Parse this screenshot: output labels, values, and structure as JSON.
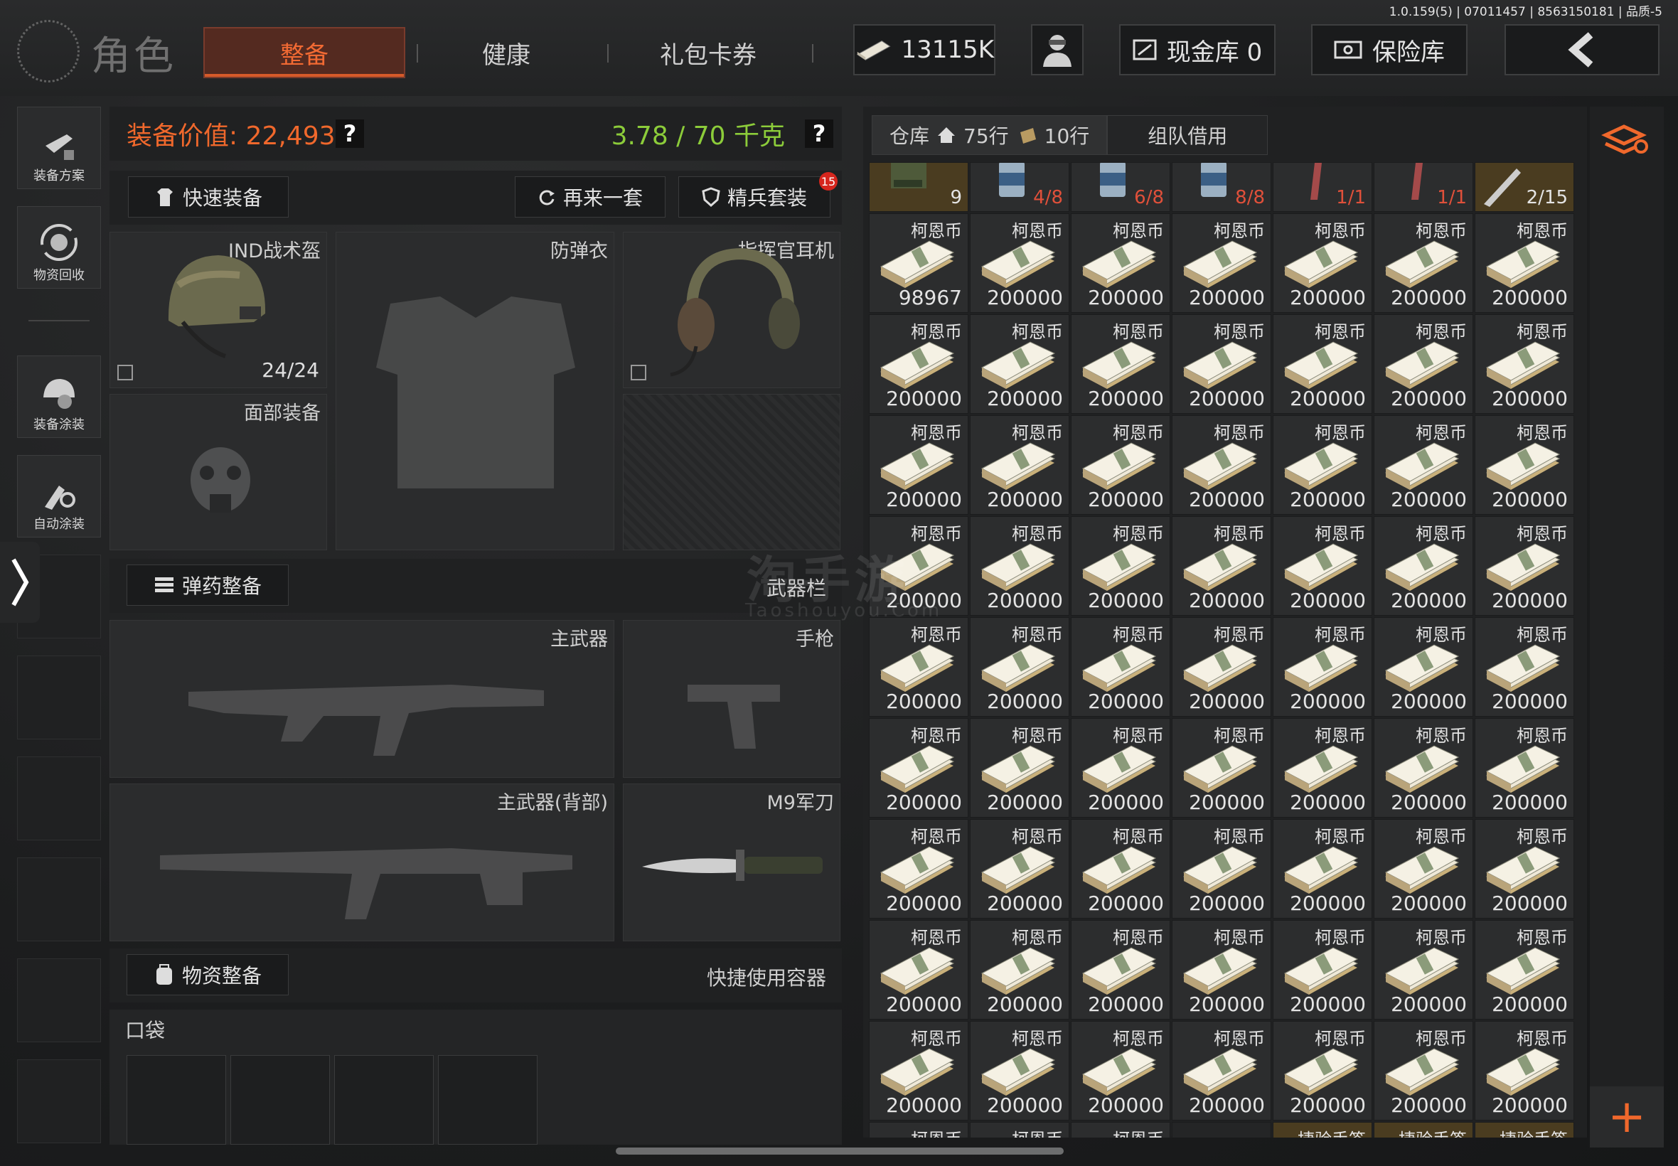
{
  "version_info": "1.0.159(5) | 07011457 | 8563150181 | 品质-5",
  "header": {
    "title": "角色",
    "tabs": [
      {
        "label": "整备",
        "active": true
      },
      {
        "label": "健康",
        "active": false
      },
      {
        "label": "礼包卡券",
        "active": false
      }
    ],
    "money": "13115K",
    "cash_vault": "现金库 0",
    "safe": "保险库"
  },
  "rail": {
    "items": [
      "装备方案",
      "物资回收",
      "装备涂装",
      "自动涂装"
    ]
  },
  "loadout": {
    "equip_value": "装备价值: 22,493",
    "weight": "3.78 / 70 千克",
    "help": "?",
    "quick_equip": "快速装备",
    "reroll": "再来一套",
    "elite_set": "精兵套装",
    "elite_badge": "15",
    "slots": {
      "helmet": {
        "label": "IND战术盔",
        "count": "24/24"
      },
      "armor": {
        "label": "防弹衣"
      },
      "headset": {
        "label": "指挥官耳机"
      },
      "face": {
        "label": "面部装备"
      }
    },
    "ammo_button": "弹药整备",
    "weapon_bar": "武器栏",
    "weapons": {
      "primary": "主武器",
      "pistol": "手枪",
      "primary_back": "主武器(背部)",
      "melee": "M9军刀"
    },
    "supply_button": "物资整备",
    "quick_container": "快捷使用容器",
    "pocket": "口袋"
  },
  "warehouse": {
    "tab_warehouse": "仓库",
    "rows_home": "75行",
    "rows_bag": "10行",
    "tab_team": "组队借用",
    "top_row": [
      {
        "count": "9",
        "color": "#e4e4e4",
        "kind": "ammo"
      },
      {
        "count": "4/8",
        "color": "#e0503a",
        "kind": "can"
      },
      {
        "count": "6/8",
        "color": "#e0503a",
        "kind": "can"
      },
      {
        "count": "8/8",
        "color": "#e0503a",
        "kind": "can"
      },
      {
        "count": "1/1",
        "color": "#e0503a",
        "kind": "tube"
      },
      {
        "count": "1/1",
        "color": "#e0503a",
        "kind": "tube"
      },
      {
        "count": "2/15",
        "color": "#e4e4e4",
        "kind": "knife"
      }
    ],
    "item_name": "柯恩币",
    "grid": [
      [
        "98967",
        "200000",
        "200000",
        "200000",
        "200000",
        "200000",
        "200000"
      ],
      [
        "200000",
        "200000",
        "200000",
        "200000",
        "200000",
        "200000",
        "200000"
      ],
      [
        "200000",
        "200000",
        "200000",
        "200000",
        "200000",
        "200000",
        "200000"
      ],
      [
        "200000",
        "200000",
        "200000",
        "200000",
        "200000",
        "200000",
        "200000"
      ],
      [
        "200000",
        "200000",
        "200000",
        "200000",
        "200000",
        "200000",
        "200000"
      ],
      [
        "200000",
        "200000",
        "200000",
        "200000",
        "200000",
        "200000",
        "200000"
      ],
      [
        "200000",
        "200000",
        "200000",
        "200000",
        "200000",
        "200000",
        "200000"
      ],
      [
        "200000",
        "200000",
        "200000",
        "200000",
        "200000",
        "200000",
        "200000"
      ],
      [
        "200000",
        "200000",
        "200000",
        "200000",
        "200000",
        "200000",
        "200000"
      ]
    ],
    "bottom_row": [
      "柯恩币",
      "柯恩币",
      "柯恩币",
      "",
      "捷验手签",
      "捷验手签",
      "捷验手签"
    ],
    "add": "+"
  },
  "watermark": {
    "main": "淘手游",
    "sub": "Taoshouyou.Com"
  },
  "colors": {
    "accent": "#f0682c",
    "weight": "#8ccc3a",
    "alert": "#e0503a"
  }
}
